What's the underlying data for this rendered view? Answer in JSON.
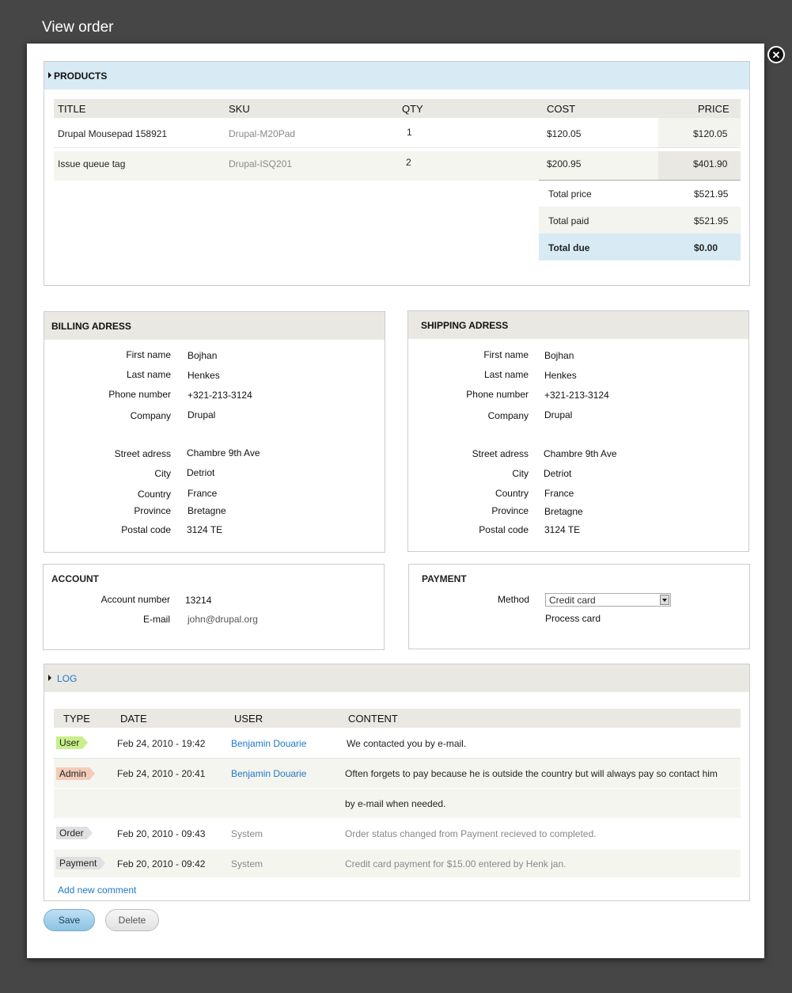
{
  "window_title": "View order",
  "close_glyph": "✕",
  "products": {
    "label": "PRODUCTS",
    "columns": [
      "TITLE",
      "SKU",
      "QTY",
      "COST",
      "PRICE"
    ],
    "rows": [
      {
        "title": "Drupal Mousepad 158921",
        "sku": "Drupal-M20Pad",
        "qty": "1",
        "cost": "$120.05",
        "price": "$120.05"
      },
      {
        "title": "Issue queue tag",
        "sku": "Drupal-ISQ201",
        "qty": "2",
        "cost": "$200.95",
        "price": "$401.90"
      }
    ],
    "totals": [
      {
        "label": "Total price",
        "value": "$521.95"
      },
      {
        "label": "Total paid",
        "value": "$521.95"
      },
      {
        "label": "Total due",
        "value": "$0.00"
      }
    ]
  },
  "billing": {
    "label": "BILLING ADRESS",
    "fields": [
      {
        "label": "First name",
        "value": "Bojhan"
      },
      {
        "label": "Last name",
        "value": "Henkes"
      },
      {
        "label": "Phone number",
        "value": "+321-213-3124"
      },
      {
        "label": "Company",
        "value": "Drupal"
      },
      {
        "label": "Street adress",
        "value": "Chambre 9th Ave"
      },
      {
        "label": "City",
        "value": "Detriot"
      },
      {
        "label": "Country",
        "value": "France"
      },
      {
        "label": "Province",
        "value": "Bretagne"
      },
      {
        "label": "Postal code",
        "value": "3124 TE"
      }
    ]
  },
  "shipping": {
    "label": "SHIPPING ADRESS",
    "fields": [
      {
        "label": "First name",
        "value": "Bojhan"
      },
      {
        "label": "Last name",
        "value": "Henkes"
      },
      {
        "label": "Phone number",
        "value": "+321-213-3124"
      },
      {
        "label": "Company",
        "value": "Drupal"
      },
      {
        "label": "Street adress",
        "value": "Chambre 9th Ave"
      },
      {
        "label": "City",
        "value": "Detriot"
      },
      {
        "label": "Country",
        "value": "France"
      },
      {
        "label": "Province",
        "value": "Bretagne"
      },
      {
        "label": "Postal code",
        "value": "3124 TE"
      }
    ]
  },
  "account": {
    "label": "ACCOUNT",
    "number_label": "Account number",
    "number": "13214",
    "email_label": "E-mail",
    "email": "john@drupal.org"
  },
  "payment": {
    "label": "PAYMENT",
    "method_label": "Method",
    "method": "Credit card",
    "process_link": "Process card"
  },
  "log": {
    "label": "LOG",
    "columns": [
      "TYPE",
      "DATE",
      "USER",
      "CONTENT"
    ],
    "rows": [
      {
        "type": "User",
        "date": "Feb 24, 2010 - 19:42",
        "user": "Benjamin Douarie",
        "content": "We contacted you by e-mail."
      },
      {
        "type": "Admin",
        "date": "Feb 24, 2010 - 20:41",
        "user": "Benjamin Douarie",
        "content": "Often forgets to pay because he is outside the country but will always pay so contact him",
        "content2": "by e-mail when needed."
      },
      {
        "type": "Order",
        "date": "Feb 20, 2010 - 09:43",
        "user": "System",
        "content": "Order status changed from Payment recieved to completed."
      },
      {
        "type": "Payment",
        "date": "Feb 20, 2010 - 09:42",
        "user": "System",
        "content": "Credit card payment for $15.00 entered by Henk jan."
      }
    ],
    "add_comment": "Add new comment"
  },
  "buttons": {
    "save": "Save",
    "delete": "Delete"
  },
  "colors": {
    "accent_blue": "#d8eaf4",
    "link": "#1f76c4",
    "tag_user": "#c8f08a",
    "tag_admin": "#f3cdb9",
    "tag_neutral": "#e0e0e0"
  }
}
